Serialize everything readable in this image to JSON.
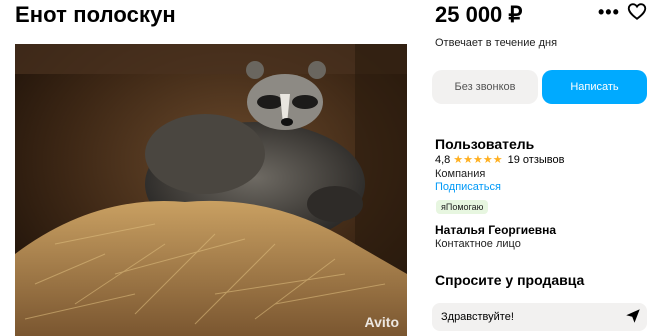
{
  "listing": {
    "title": "Енот полоскун",
    "price": "25 000 ₽",
    "reply_time": "Отвечает в течение дня",
    "watermark": "Avito"
  },
  "actions": {
    "no_calls": "Без звонков",
    "write": "Написать"
  },
  "seller": {
    "name": "Пользователь",
    "rating": "4,8",
    "stars": "★★★★★",
    "reviews": "19 отзывов",
    "type": "Компания",
    "subscribe": "Подписаться",
    "badge": "яПомогаю",
    "contact_name": "Наталья Георгиевна",
    "contact_role": "Контактное лицо"
  },
  "ask": {
    "title": "Спросите у продавца",
    "message_value": "Здравствуйте!"
  },
  "icons": {
    "more": "more-dots-icon",
    "favorite": "heart-icon",
    "send": "send-icon",
    "star": "star-icon"
  },
  "colors": {
    "accent": "#00aaff",
    "link": "#0099f7",
    "star": "#ffb021",
    "badge_bg": "#e7f6e0",
    "button_gray": "#f2f1f0"
  }
}
